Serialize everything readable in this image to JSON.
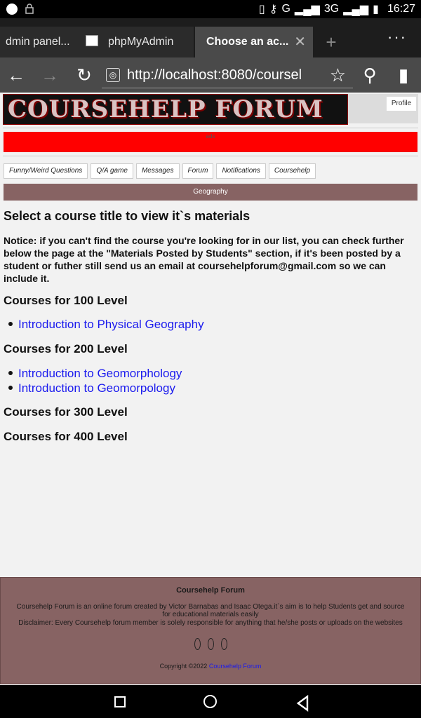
{
  "status_bar": {
    "network": "G",
    "network_3g": "3G",
    "time": "16:27"
  },
  "tabs": [
    {
      "label": "dmin panel..."
    },
    {
      "label": "phpMyAdmin"
    },
    {
      "label": "Choose an ac..."
    }
  ],
  "toolbar": {
    "url": "http://localhost:8080/coursel"
  },
  "site": {
    "logo_text": "COURSEHELP FORUM",
    "profile_label": "Profile",
    "ads_label": "ads",
    "nav": [
      {
        "label": "Funny/Weird Questions"
      },
      {
        "label": "Q/A game"
      },
      {
        "label": "Messages"
      },
      {
        "label": "Forum"
      },
      {
        "label": "Notifications"
      },
      {
        "label": "Coursehelp"
      }
    ],
    "category": "Geography"
  },
  "main": {
    "title": "Select a course title to view it`s materials",
    "notice": "Notice: if you can't find the course you're looking for in our list, you can check further below the page at the \"Materials Posted by Students\" section, if it's been posted by a student or futher still send us an email at coursehelpforum@gmail.com so we can include it.",
    "levels": [
      {
        "heading": "Courses for 100 Level",
        "courses": [
          "Introduction to Physical Geography"
        ]
      },
      {
        "heading": "Courses for 200 Level",
        "courses": [
          "Introduction to Geomorphology",
          "Introduction to Geomorpology"
        ]
      },
      {
        "heading": "Courses for 300 Level",
        "courses": []
      },
      {
        "heading": "Courses for 400 Level",
        "courses": []
      }
    ]
  },
  "footer": {
    "title": "Coursehelp Forum",
    "description": "Coursehelp Forum is an online forum created by Victor Barnabas and Isaac Otega.it`s aim is to help Students get and source for educational materials easily",
    "disclaimer": "Disclaimer: Every Coursehelp forum member is solely responsible for anything that he/she posts or uploads on the websites",
    "copyright": "Copyright ©2022",
    "copyright_link": "Coursehelp Forum"
  }
}
